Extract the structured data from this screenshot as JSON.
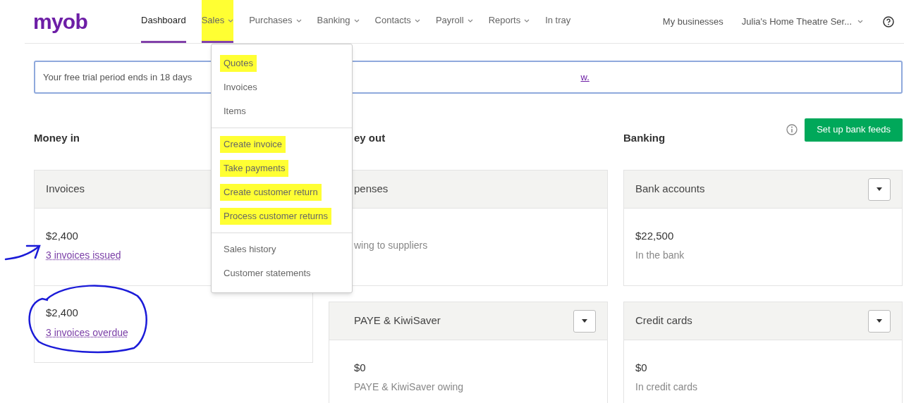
{
  "logo": "myob",
  "nav": [
    {
      "label": "Dashboard",
      "selected": true,
      "expanded": false,
      "has_menu": false,
      "highlighted": false
    },
    {
      "label": "Sales",
      "selected": false,
      "expanded": true,
      "has_menu": true,
      "highlighted": true
    },
    {
      "label": "Purchases",
      "selected": false,
      "expanded": false,
      "has_menu": true,
      "highlighted": false
    },
    {
      "label": "Banking",
      "selected": false,
      "expanded": false,
      "has_menu": true,
      "highlighted": false
    },
    {
      "label": "Contacts",
      "selected": false,
      "expanded": false,
      "has_menu": true,
      "highlighted": false
    },
    {
      "label": "Payroll",
      "selected": false,
      "expanded": false,
      "has_menu": true,
      "highlighted": false
    },
    {
      "label": "Reports",
      "selected": false,
      "expanded": false,
      "has_menu": true,
      "highlighted": false
    },
    {
      "label": "In tray",
      "selected": false,
      "expanded": false,
      "has_menu": false,
      "highlighted": false
    }
  ],
  "my_businesses": "My businesses",
  "business_name": "Julia's Home Theatre Ser...",
  "banner": {
    "text": "Your free trial period ends in 18 days",
    "link": "w."
  },
  "sales_menu": {
    "groups": [
      {
        "items": [
          {
            "label": "Quotes",
            "highlighted": true
          },
          {
            "label": "Invoices",
            "highlighted": false
          },
          {
            "label": "Items",
            "highlighted": false
          }
        ]
      },
      {
        "items": [
          {
            "label": "Create invoice",
            "highlighted": true
          },
          {
            "label": "Take payments",
            "highlighted": true
          },
          {
            "label": "Create customer return",
            "highlighted": true
          },
          {
            "label": "Process customer returns",
            "highlighted": true
          }
        ]
      },
      {
        "items": [
          {
            "label": "Sales history",
            "highlighted": false
          },
          {
            "label": "Customer statements",
            "highlighted": false
          }
        ]
      }
    ]
  },
  "columns": [
    {
      "title": "Money in",
      "covered_by_menu": false,
      "cards": [
        {
          "title": "Invoices",
          "has_menu": false,
          "sections": [
            {
              "amount": "$2,400",
              "caption": "3 invoices issued",
              "kind": "link"
            },
            {
              "amount": "$2,400",
              "caption": "3 invoices overdue",
              "kind": "link"
            }
          ]
        }
      ]
    },
    {
      "title": "ey out",
      "covered_by_menu": true,
      "cards": [
        {
          "title": "penses",
          "has_menu": false,
          "sections": [
            {
              "caption": "wing to suppliers",
              "kind": "text"
            }
          ]
        },
        {
          "title": "PAYE & KiwiSaver",
          "has_menu": true,
          "sections": [
            {
              "amount": "$0",
              "caption": "PAYE & KiwiSaver owing",
              "kind": "text"
            }
          ]
        }
      ]
    },
    {
      "title": "Banking",
      "covered_by_menu": false,
      "action": "Set up bank feeds",
      "cards": [
        {
          "title": "Bank accounts",
          "has_menu": true,
          "sections": [
            {
              "amount": "$22,500",
              "caption": "In the bank",
              "kind": "text"
            }
          ]
        },
        {
          "title": "Credit cards",
          "has_menu": true,
          "sections": [
            {
              "amount": "$0",
              "caption": "In credit cards",
              "kind": "text"
            }
          ]
        }
      ]
    }
  ]
}
